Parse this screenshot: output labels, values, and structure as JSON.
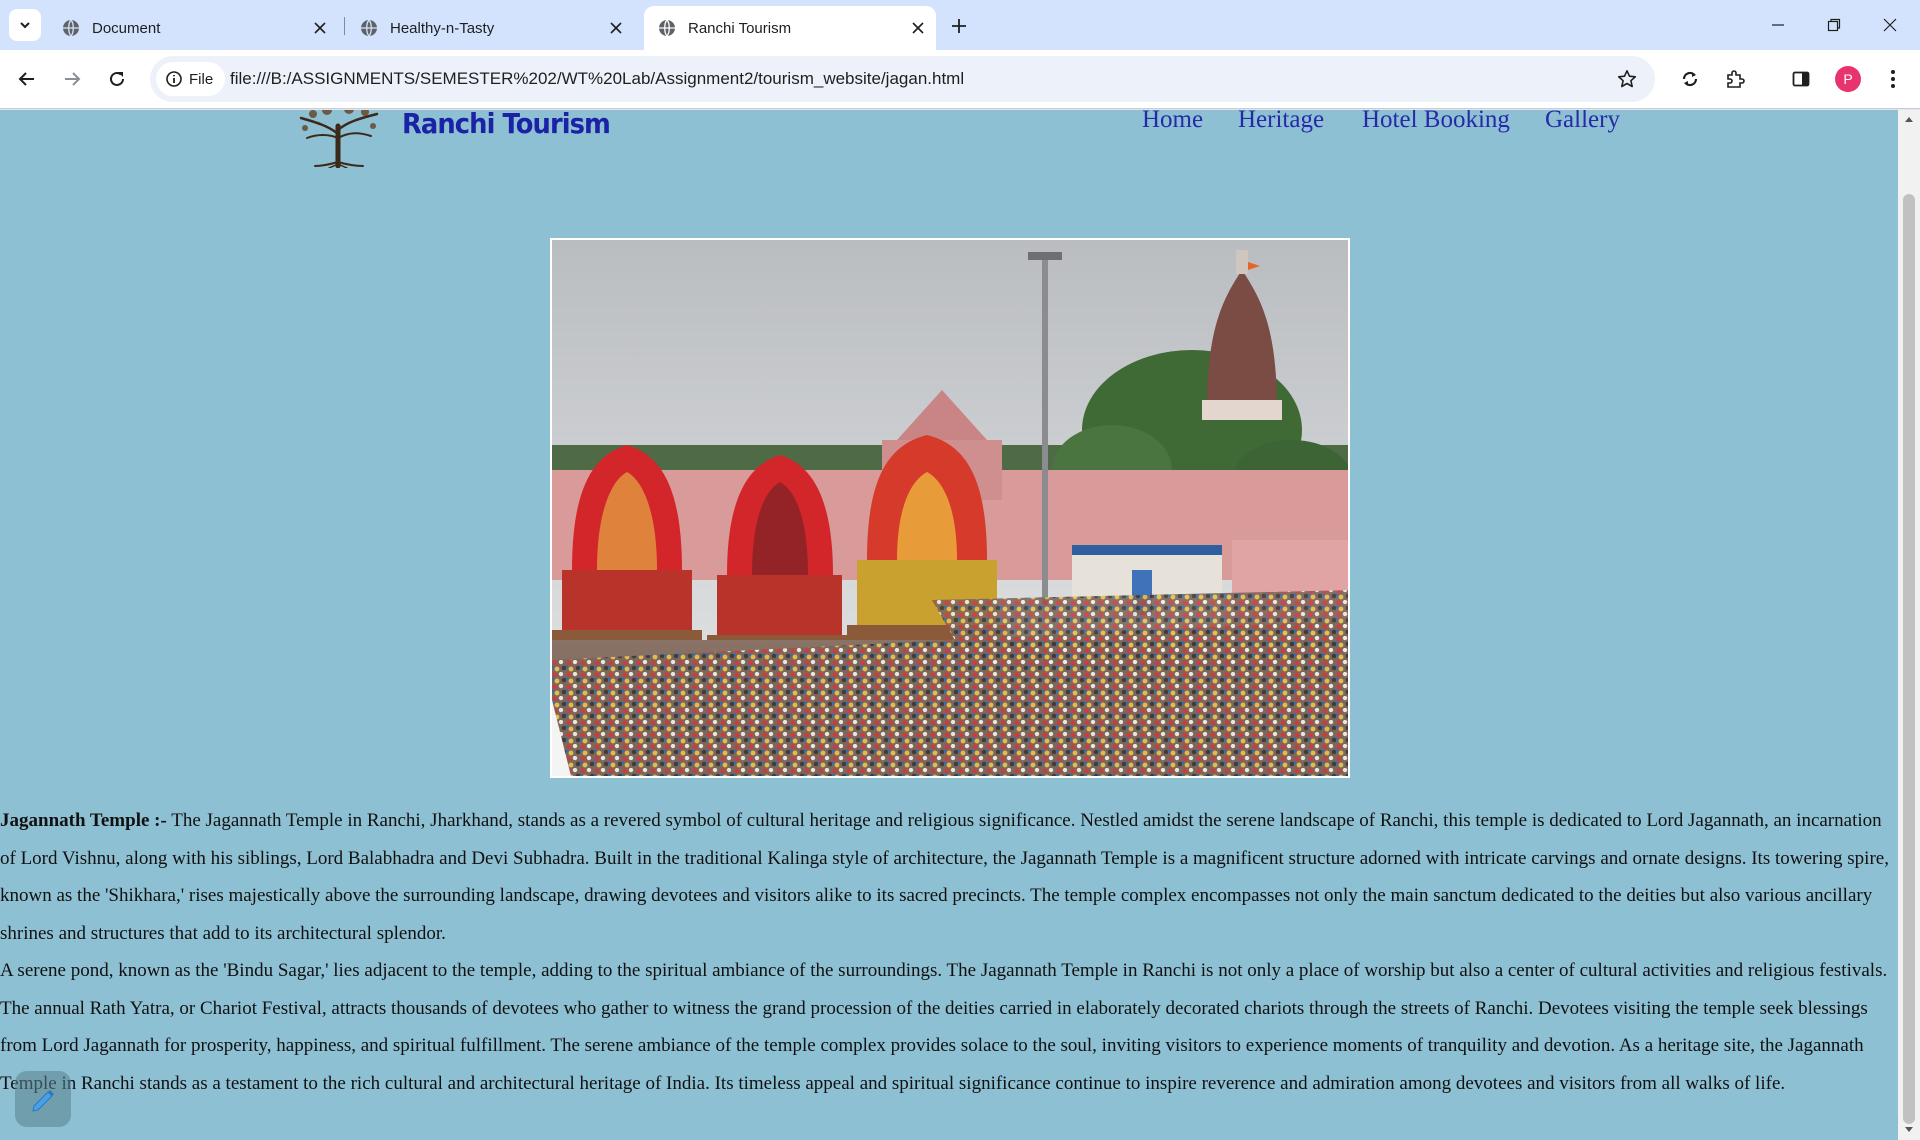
{
  "browser": {
    "tabs": [
      {
        "title": "Document",
        "active": false
      },
      {
        "title": "Healthy-n-Tasty",
        "active": false
      },
      {
        "title": "Ranchi Tourism",
        "active": true
      }
    ],
    "site_chip_label": "File",
    "url": "file:///B:/ASSIGNMENTS/SEMESTER%202/WT%20Lab/Assignment2/tourism_website/jagan.html",
    "profile_initial": "P"
  },
  "site": {
    "name": "Ranchi Tourism",
    "nav": [
      "Home",
      "Heritage",
      "Hotel Booking",
      "Gallery"
    ]
  },
  "article": {
    "heading": "Jagannath Temple :-",
    "para1": " The Jagannath Temple in Ranchi, Jharkhand, stands as a revered symbol of cultural heritage and religious significance. Nestled amidst the serene landscape of Ranchi, this temple is dedicated to Lord Jagannath, an incarnation of Lord Vishnu, along with his siblings, Lord Balabhadra and Devi Subhadra. Built in the traditional Kalinga style of architecture, the Jagannath Temple is a magnificent structure adorned with intricate carvings and ornate designs. Its towering spire, known as the 'Shikhara,' rises majestically above the surrounding landscape, drawing devotees and visitors alike to its sacred precincts. The temple complex encompasses not only the main sanctum dedicated to the deities but also various ancillary shrines and structures that add to its architectural splendor.",
    "para2": "A serene pond, known as the 'Bindu Sagar,' lies adjacent to the temple, adding to the spiritual ambiance of the surroundings. The Jagannath Temple in Ranchi is not only a place of worship but also a center of cultural activities and religious festivals. The annual Rath Yatra, or Chariot Festival, attracts thousands of devotees who gather to witness the grand procession of the deities carried in elaborately decorated chariots through the streets of Ranchi. Devotees visiting the temple seek blessings from Lord Jagannath for prosperity, happiness, and spiritual fulfillment. The serene ambiance of the temple complex provides solace to the soul, inviting visitors to experience moments of tranquility and devotion. As a heritage site, the Jagannath Temple in Ranchi stands as a testament to the rich cultural and architectural heritage of India. Its timeless appeal and spiritual significance continue to inspire reverence and admiration among devotees and visitors from all walks of life."
  },
  "colors": {
    "page_background": "#8ec0d3",
    "brand": "#1c22a6",
    "nav_link": "#2629a8",
    "tabstrip": "#d3e3fd"
  }
}
